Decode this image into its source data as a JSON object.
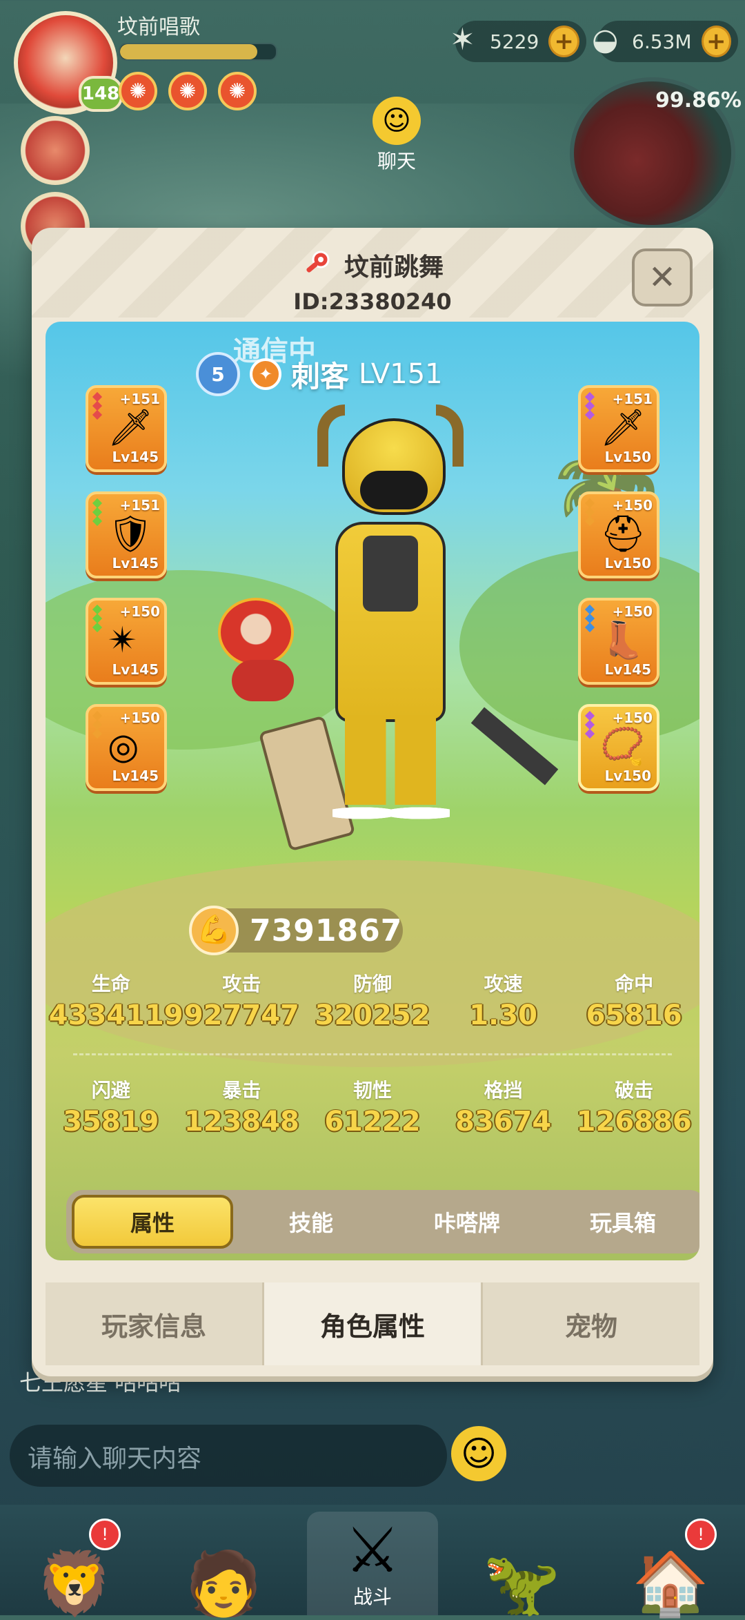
{
  "hud": {
    "player_name": "坟前唱歌",
    "level": "148",
    "xp_fraction": 0.88,
    "buffs": [
      "buff-1",
      "buff-2",
      "buff-3"
    ],
    "starfish_amount": "5229",
    "shell_amount": "6.53M",
    "map_percent": "99.86%",
    "chat_label": "聊天",
    "chat_line": "七王愿星  咕咕咕",
    "chat_placeholder": "请输入聊天内容"
  },
  "modal": {
    "title": "坟前跳舞",
    "player_id": "ID:23380240",
    "close_label": "✕",
    "comm_status": "通信中",
    "rank_number": "5",
    "class_name": "刺客",
    "class_level": "LV151",
    "power_value": "7391867",
    "stats_row1": [
      {
        "label": "生命",
        "value": "4334119"
      },
      {
        "label": "攻击",
        "value": "927747"
      },
      {
        "label": "防御",
        "value": "320252"
      },
      {
        "label": "攻速",
        "value": "1.30"
      },
      {
        "label": "命中",
        "value": "65816"
      }
    ],
    "stats_row2": [
      {
        "label": "闪避",
        "value": "35819"
      },
      {
        "label": "暴击",
        "value": "123848"
      },
      {
        "label": "韧性",
        "value": "61222"
      },
      {
        "label": "格挡",
        "value": "83674"
      },
      {
        "label": "破击",
        "value": "126886"
      }
    ],
    "tabs": [
      "属性",
      "技能",
      "咔嗒牌",
      "玩具箱"
    ],
    "bottom_tabs": [
      "玩家信息",
      "角色属性",
      "宠物"
    ]
  },
  "equipment": {
    "left": [
      {
        "plus": "+151",
        "level": "Lv145",
        "icon": "sword-icon"
      },
      {
        "plus": "+151",
        "level": "Lv145",
        "icon": "bracer-icon"
      },
      {
        "plus": "+150",
        "level": "Lv145",
        "icon": "armor-icon"
      },
      {
        "plus": "+150",
        "level": "Lv145",
        "icon": "ring-icon"
      }
    ],
    "right": [
      {
        "plus": "+151",
        "level": "Lv150",
        "icon": "sword-icon"
      },
      {
        "plus": "+150",
        "level": "Lv150",
        "icon": "helmet-icon"
      },
      {
        "plus": "+150",
        "level": "Lv145",
        "icon": "boots-icon"
      },
      {
        "plus": "+150",
        "level": "Lv150",
        "icon": "necklace-icon"
      }
    ]
  },
  "nav": {
    "items": [
      "tribe",
      "hero",
      "battle",
      "pet",
      "shop"
    ],
    "battle_label": "战斗",
    "badge_text": "!"
  },
  "colors": {
    "accent_gold": "#f7d54a",
    "equip_orange": "#e97d1c",
    "panel_bg": "#efe8d8"
  }
}
